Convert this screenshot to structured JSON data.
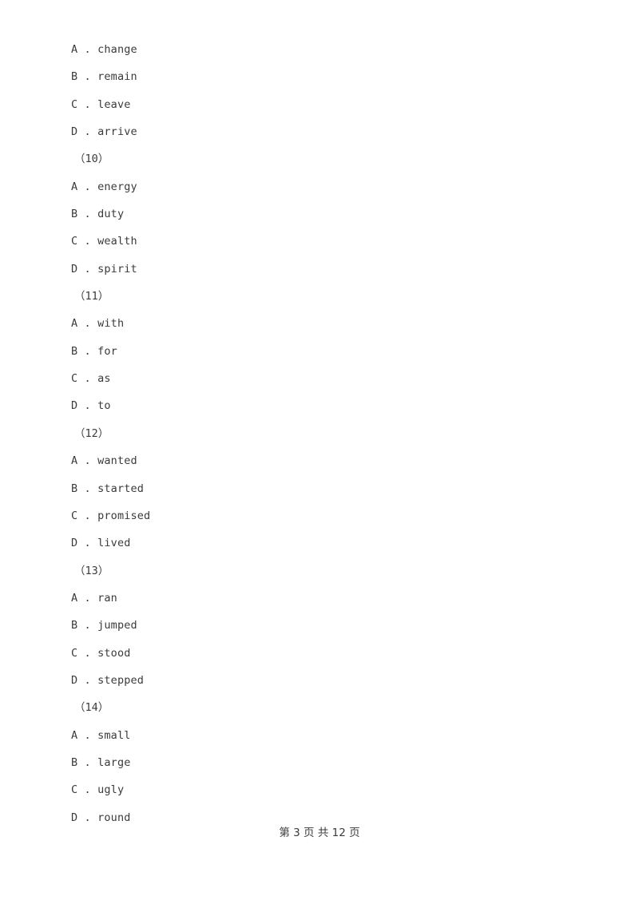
{
  "document": {
    "page_background": "#ffffff",
    "text_color": "#3b3b3b",
    "footer": "第 3 页 共 12 页"
  },
  "blocks": [
    {
      "type": "option",
      "text": "A . change"
    },
    {
      "type": "option",
      "text": "B . remain"
    },
    {
      "type": "option",
      "text": "C . leave"
    },
    {
      "type": "option",
      "text": "D . arrive"
    },
    {
      "type": "question",
      "text": "（10）"
    },
    {
      "type": "option",
      "text": "A . energy"
    },
    {
      "type": "option",
      "text": "B . duty"
    },
    {
      "type": "option",
      "text": "C . wealth"
    },
    {
      "type": "option",
      "text": "D . spirit"
    },
    {
      "type": "question",
      "text": "（11）"
    },
    {
      "type": "option",
      "text": "A . with"
    },
    {
      "type": "option",
      "text": "B . for"
    },
    {
      "type": "option",
      "text": "C . as"
    },
    {
      "type": "option",
      "text": "D . to"
    },
    {
      "type": "question",
      "text": "（12）"
    },
    {
      "type": "option",
      "text": "A . wanted"
    },
    {
      "type": "option",
      "text": "B . started"
    },
    {
      "type": "option",
      "text": "C . promised"
    },
    {
      "type": "option",
      "text": "D . lived"
    },
    {
      "type": "question",
      "text": "（13）"
    },
    {
      "type": "option",
      "text": "A . ran"
    },
    {
      "type": "option",
      "text": "B . jumped"
    },
    {
      "type": "option",
      "text": "C . stood"
    },
    {
      "type": "option",
      "text": "D . stepped"
    },
    {
      "type": "question",
      "text": "（14）"
    },
    {
      "type": "option",
      "text": "A . small"
    },
    {
      "type": "option",
      "text": "B . large"
    },
    {
      "type": "option",
      "text": "C . ugly"
    },
    {
      "type": "option",
      "text": "D . round"
    }
  ]
}
